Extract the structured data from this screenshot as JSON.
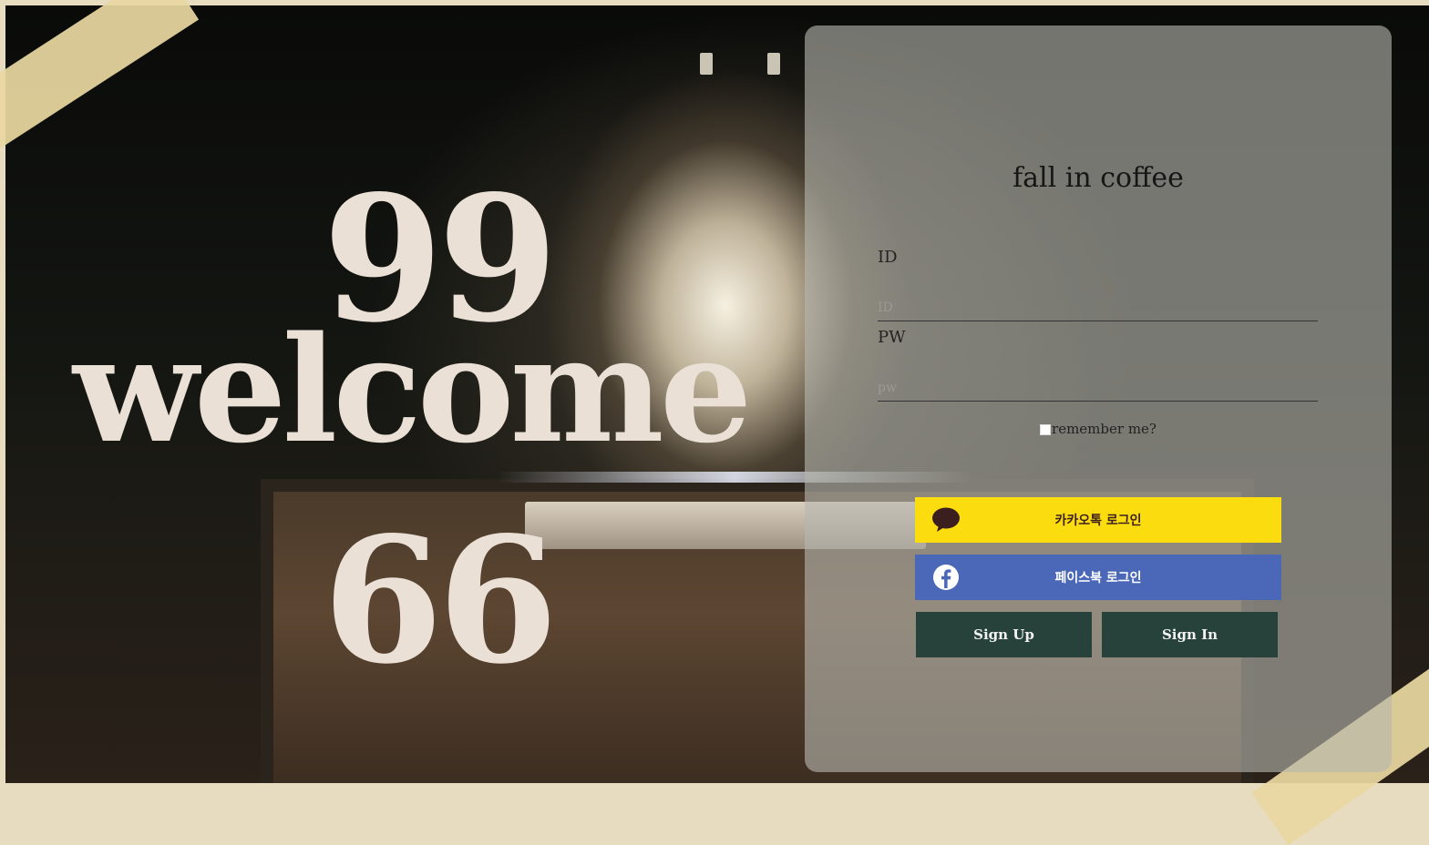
{
  "hero": {
    "open_quote": "99",
    "welcome": "welcome",
    "close_quote": "66"
  },
  "login": {
    "brand_title": "fall in coffee",
    "id_label": "ID",
    "id_placeholder": "ID",
    "pw_label": "PW",
    "pw_placeholder": "pw",
    "remember_label": "remember me?",
    "kakao_label": "카카오톡 로그인",
    "facebook_label": "페이스북 로그인",
    "signup_label": "Sign Up",
    "signin_label": "Sign In"
  },
  "icons": {
    "kakao": "kakao-chat-icon",
    "facebook": "facebook-icon"
  },
  "colors": {
    "kakao_yellow": "#fbdc0f",
    "facebook_blue": "#4a67b8",
    "action_green": "#27413b",
    "tape": "#e8d7a0"
  }
}
